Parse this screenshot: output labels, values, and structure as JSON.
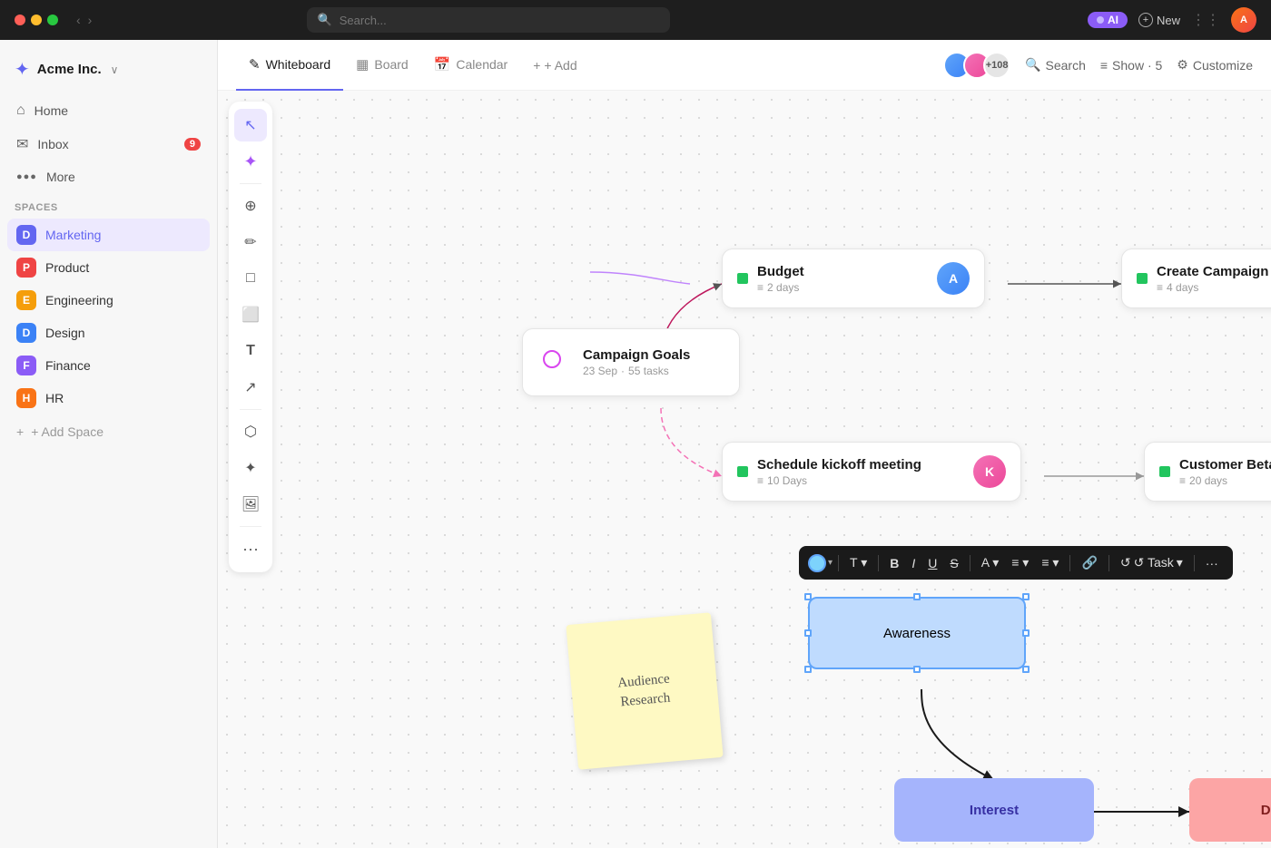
{
  "titlebar": {
    "dots": [
      "red",
      "yellow",
      "green"
    ],
    "search_placeholder": "Search...",
    "ai_label": "AI",
    "new_label": "New"
  },
  "sidebar": {
    "logo": "Acme Inc.",
    "nav": [
      {
        "id": "home",
        "label": "Home",
        "icon": "⌂",
        "badge": null
      },
      {
        "id": "inbox",
        "label": "Inbox",
        "icon": "✉",
        "badge": "9"
      },
      {
        "id": "more",
        "label": "More",
        "icon": "○○○",
        "badge": null
      }
    ],
    "spaces_title": "Spaces",
    "spaces": [
      {
        "id": "marketing",
        "label": "Marketing",
        "color": "#6366f1",
        "initial": "D",
        "active": true
      },
      {
        "id": "product",
        "label": "Product",
        "color": "#ef4444",
        "initial": "P"
      },
      {
        "id": "engineering",
        "label": "Engineering",
        "color": "#f59e0b",
        "initial": "E"
      },
      {
        "id": "design",
        "label": "Design",
        "color": "#3b82f6",
        "initial": "D"
      },
      {
        "id": "finance",
        "label": "Finance",
        "color": "#8b5cf6",
        "initial": "F"
      },
      {
        "id": "hr",
        "label": "HR",
        "color": "#f97316",
        "initial": "H"
      }
    ],
    "add_space": "+ Add Space"
  },
  "topbar": {
    "tabs": [
      {
        "id": "whiteboard",
        "label": "Whiteboard",
        "icon": "✎",
        "active": true
      },
      {
        "id": "board",
        "label": "Board",
        "icon": "▦"
      },
      {
        "id": "calendar",
        "label": "Calendar",
        "icon": "📅"
      }
    ],
    "add_label": "+ Add",
    "search_label": "Search",
    "show_label": "Show · 5",
    "customize_label": "Customize",
    "avatar_count": "+108"
  },
  "canvas": {
    "nodes": {
      "budget": {
        "title": "Budget",
        "sub": "2 days"
      },
      "create_campaign": {
        "title": "Create Campaign",
        "sub": "4 days"
      },
      "campaign_goals": {
        "title": "Campaign Goals",
        "date": "23 Sep",
        "separator": "·",
        "tasks": "55 tasks"
      },
      "schedule_kickoff": {
        "title": "Schedule kickoff meeting",
        "sub": "10 Days"
      },
      "customer_beta": {
        "title": "Customer Beta",
        "sub": "20 days"
      }
    },
    "sticky": {
      "text": "Audience\nResearch"
    },
    "flow": {
      "awareness": "Awareness",
      "interest": "Interest",
      "decision": "Decision"
    }
  },
  "toolbar": {
    "tools": [
      {
        "id": "select",
        "icon": "↖",
        "label": "Select"
      },
      {
        "id": "magic",
        "icon": "✦",
        "label": "Magic"
      },
      {
        "id": "globe",
        "icon": "⊕",
        "label": "Globe"
      },
      {
        "id": "pen",
        "icon": "✏",
        "label": "Pen"
      },
      {
        "id": "rect",
        "icon": "□",
        "label": "Rectangle"
      },
      {
        "id": "note",
        "icon": "⬜",
        "label": "Note"
      },
      {
        "id": "text",
        "icon": "T",
        "label": "Text"
      },
      {
        "id": "arrow",
        "icon": "↗",
        "label": "Arrow"
      },
      {
        "id": "connect",
        "icon": "⬡",
        "label": "Connect"
      },
      {
        "id": "sparkle",
        "icon": "✦",
        "label": "Sparkle"
      },
      {
        "id": "image",
        "icon": "🖼",
        "label": "Image"
      },
      {
        "id": "more2",
        "icon": "···",
        "label": "More"
      }
    ]
  },
  "text_toolbar": {
    "color_label": "Color",
    "font_label": "T",
    "bold": "B",
    "italic": "I",
    "underline": "U",
    "strikethrough": "S",
    "font_size": "A",
    "align": "≡",
    "list": "≡",
    "link": "🔗",
    "task": "↺ Task",
    "more": "···"
  }
}
